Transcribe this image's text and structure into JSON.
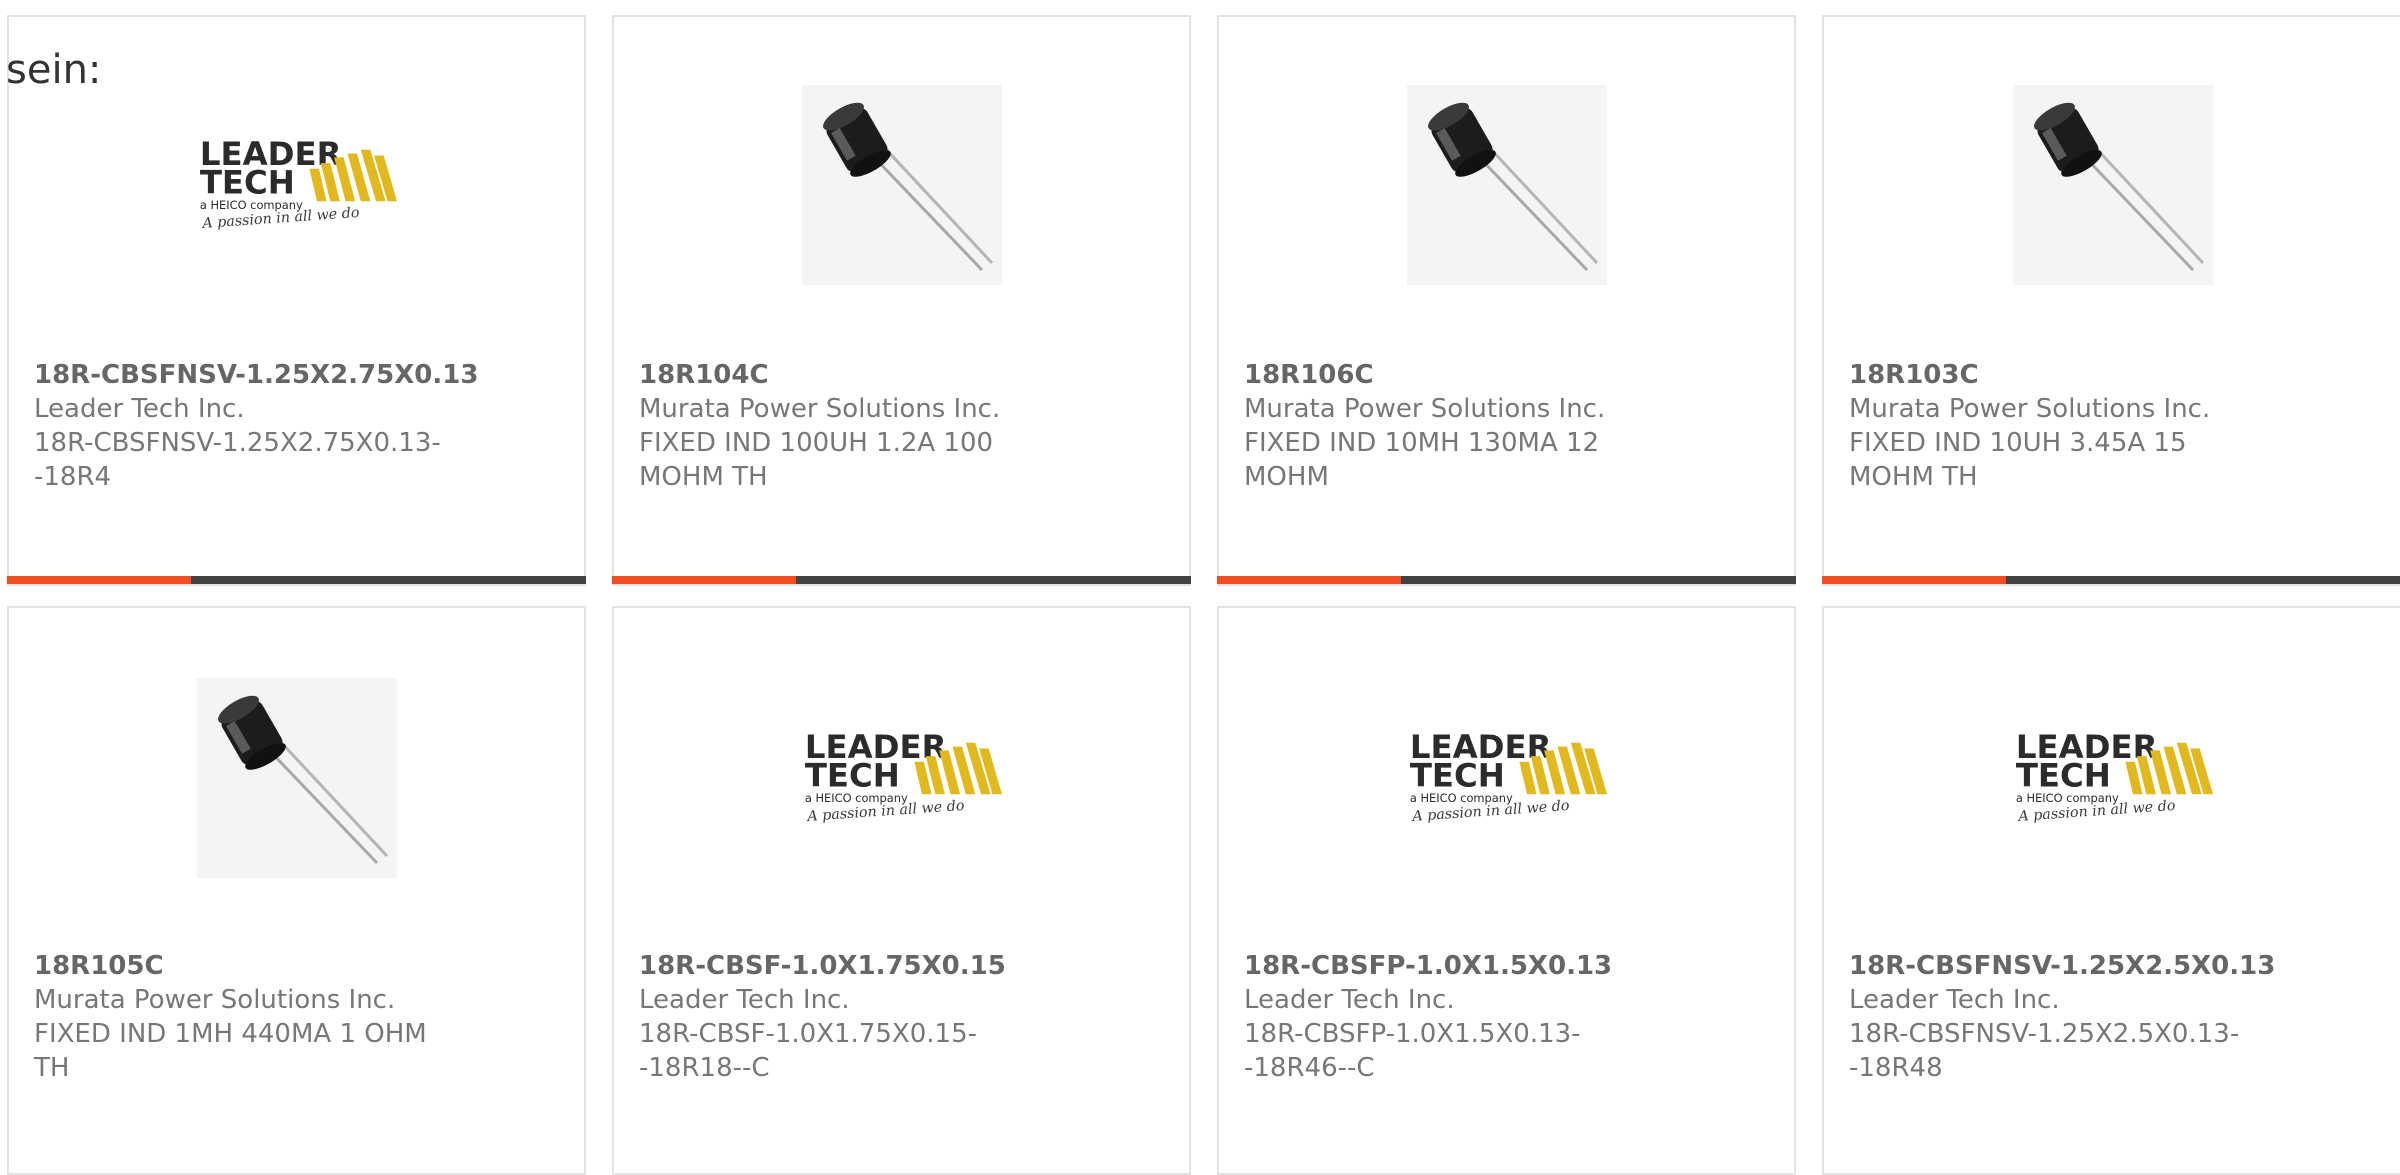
{
  "intro": {
    "text": "sein:"
  },
  "colors": {
    "card_border": "#e2e2e2",
    "bar_dark": "#424242",
    "bar_accent": "#f04e23",
    "text_gray": "#666666",
    "logo_gold": "#e2b81f"
  },
  "logo": {
    "line1": "LEADER",
    "line2": "TECH",
    "tag": "a HEICO company",
    "script": "A passion in all we do"
  },
  "products": [
    {
      "part": "18R-CBSFNSV-1.25X2.75X0.13",
      "maker": "Leader Tech Inc.",
      "desc": "18R-CBSFNSV-1.25X2.75X0.13--18R4",
      "image": "leader-tech-logo"
    },
    {
      "part": "18R104C",
      "maker": "Murata Power Solutions Inc.",
      "desc": "FIXED IND 100UH 1.2A 100 MOHM TH",
      "image": "radial-inductor"
    },
    {
      "part": "18R106C",
      "maker": "Murata Power Solutions Inc.",
      "desc": "FIXED IND 10MH 130MA 12 MOHM",
      "image": "radial-inductor"
    },
    {
      "part": "18R103C",
      "maker": "Murata Power Solutions Inc.",
      "desc": "FIXED IND 10UH 3.45A 15 MOHM TH",
      "image": "radial-inductor"
    },
    {
      "part": "18R105C",
      "maker": "Murata Power Solutions Inc.",
      "desc": "FIXED IND 1MH 440MA 1 OHM TH",
      "image": "radial-inductor"
    },
    {
      "part": "18R-CBSF-1.0X1.75X0.15",
      "maker": "Leader Tech Inc.",
      "desc": "18R-CBSF-1.0X1.75X0.15--18R18--C",
      "image": "leader-tech-logo"
    },
    {
      "part": "18R-CBSFP-1.0X1.5X0.13",
      "maker": "Leader Tech Inc.",
      "desc": "18R-CBSFP-1.0X1.5X0.13--18R46--C",
      "image": "leader-tech-logo"
    },
    {
      "part": "18R-CBSFNSV-1.25X2.5X0.13",
      "maker": "Leader Tech Inc.",
      "desc": "18R-CBSFNSV-1.25X2.5X0.13--18R48",
      "image": "leader-tech-logo"
    }
  ]
}
